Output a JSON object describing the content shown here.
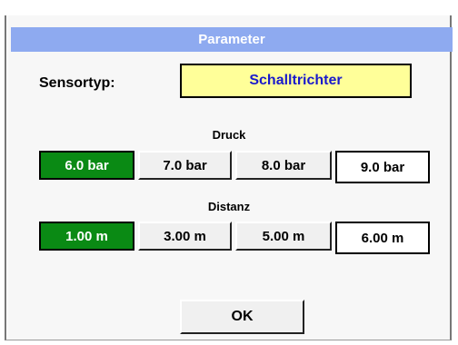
{
  "window": {
    "title": "Parameter"
  },
  "sensor": {
    "label": "Sensortyp:",
    "value": "Schalltrichter"
  },
  "pressure": {
    "label": "Druck",
    "options": [
      "6.0 bar",
      "7.0 bar",
      "8.0 bar"
    ],
    "custom_value": "9.0 bar",
    "selected": "6.0 bar"
  },
  "distance": {
    "label": "Distanz",
    "options": [
      "1.00 m",
      "3.00 m",
      "5.00 m"
    ],
    "custom_value": "6.00 m",
    "selected": "1.00 m"
  },
  "actions": {
    "ok_label": "OK"
  },
  "colors": {
    "titlebar": "#8eaaf0",
    "sensor_field": "#ffff99",
    "sensor_text": "#1a1acc",
    "selected_option": "#0a8a14"
  }
}
